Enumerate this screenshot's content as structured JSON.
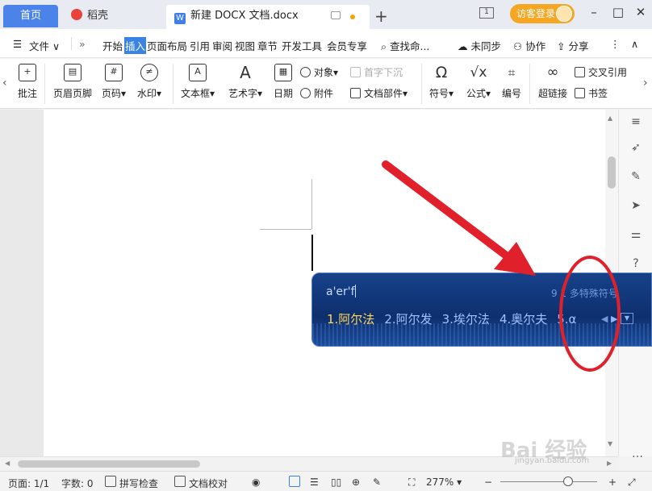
{
  "titlebar": {
    "tabs": [
      {
        "label": "首页"
      },
      {
        "label": "稻壳"
      },
      {
        "label": "新建 DOCX 文档.docx"
      }
    ],
    "page_badge": "1",
    "guest_login": "访客登录"
  },
  "menu": {
    "file": "文件",
    "items": [
      "开始",
      "插入",
      "页面布局",
      "引用",
      "审阅",
      "视图",
      "章节",
      "开发工具",
      "会员专享"
    ],
    "search_placeholder": "查找命...",
    "sync": "未同步",
    "collab": "协作",
    "share": "分享"
  },
  "ribbon": {
    "comment": "批注",
    "header_footer": "页眉页脚",
    "page_number": "页码",
    "watermark": "水印",
    "textbox": "文本框",
    "wordart": "艺术字",
    "date": "日期",
    "object": "对象",
    "attachment": "附件",
    "drop_cap": "首字下沉",
    "doc_parts": "文档部件",
    "symbol": "符号",
    "formula": "公式",
    "numbering": "编号",
    "hyperlink": "超链接",
    "cross_ref": "交叉引用",
    "bookmark": "书签"
  },
  "ime": {
    "composition": "a'er'f",
    "special": "9 1 多特殊符号",
    "candidates": [
      "1.阿尔法",
      "2.阿尔发",
      "3.埃尔法",
      "4.奥尔夫",
      "5.α"
    ]
  },
  "statusbar": {
    "page": "页面: 1/1",
    "words": "字数: 0",
    "spellcheck": "拼写检查",
    "proofread": "文档校对",
    "zoom": "277%"
  },
  "watermark": {
    "text": "Bai 经验",
    "sub": "jingyan.baidu.com"
  },
  "colors": {
    "accent": "#3b82e5",
    "annotation": "#e0202a",
    "ime_bg": "#0e2f6d"
  }
}
